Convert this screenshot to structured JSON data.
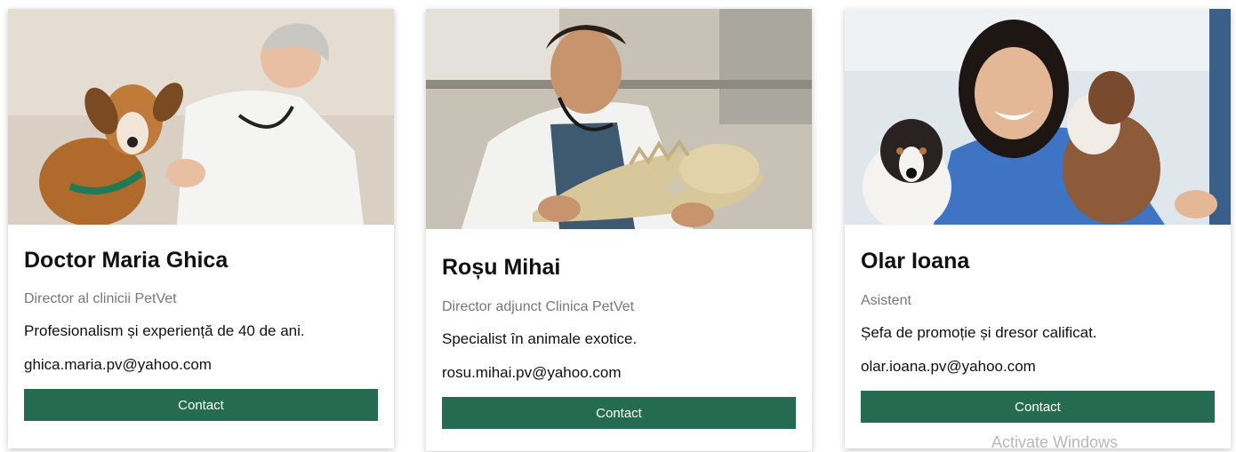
{
  "colors": {
    "accent": "#256b52",
    "subtitle": "#777777"
  },
  "cards": [
    {
      "name": "Doctor Maria Ghica",
      "role": "Director al clinicii PetVet",
      "description": "Profesionalism și experiență de 40 de ani.",
      "email": "ghica.maria.pv@yahoo.com",
      "button_label": "Contact"
    },
    {
      "name": "Roșu Mihai",
      "role": "Director adjunct Clinica PetVet",
      "description": "Specialist în animale exotice.",
      "email": "rosu.mihai.pv@yahoo.com",
      "button_label": "Contact"
    },
    {
      "name": "Olar Ioana",
      "role": "Asistent",
      "description": "Șefa de promoție și dresor calificat.",
      "email": "olar.ioana.pv@yahoo.com",
      "button_label": "Contact"
    }
  ],
  "watermark": "Activate Windows"
}
